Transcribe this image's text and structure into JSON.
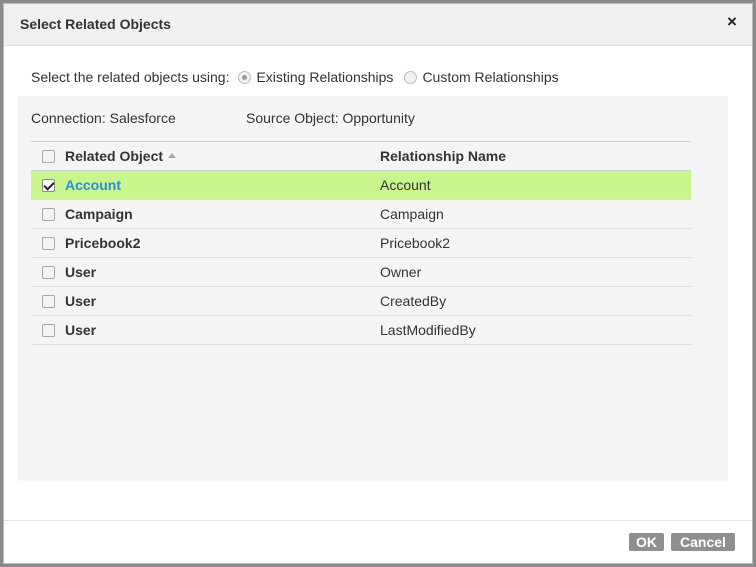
{
  "dialog": {
    "title": "Select Related Objects",
    "close_glyph": "×"
  },
  "mode": {
    "label": "Select the related objects using:",
    "options": [
      {
        "label": "Existing Relationships",
        "selected": true
      },
      {
        "label": "Custom Relationships",
        "selected": false
      }
    ]
  },
  "info": {
    "connection": "Connection: Salesforce",
    "source_object": "Source Object: Opportunity"
  },
  "grid": {
    "headers": {
      "related_object": "Related Object",
      "relationship_name": "Relationship Name"
    },
    "rows": [
      {
        "object": "Account",
        "relationship": "Account",
        "checked": true
      },
      {
        "object": "Campaign",
        "relationship": "Campaign",
        "checked": false
      },
      {
        "object": "Pricebook2",
        "relationship": "Pricebook2",
        "checked": false
      },
      {
        "object": "User",
        "relationship": "Owner",
        "checked": false
      },
      {
        "object": "User",
        "relationship": "CreatedBy",
        "checked": false
      },
      {
        "object": "User",
        "relationship": "LastModifiedBy",
        "checked": false
      }
    ]
  },
  "footer": {
    "ok_label": "OK",
    "cancel_label": "Cancel"
  },
  "colors": {
    "selected_row": "#c9f58e",
    "link_blue": "#2e8ed6",
    "button_gray": "#8f8f8f"
  },
  "icons": {
    "close": "close-icon",
    "sort": "sort-ascending-icon"
  }
}
